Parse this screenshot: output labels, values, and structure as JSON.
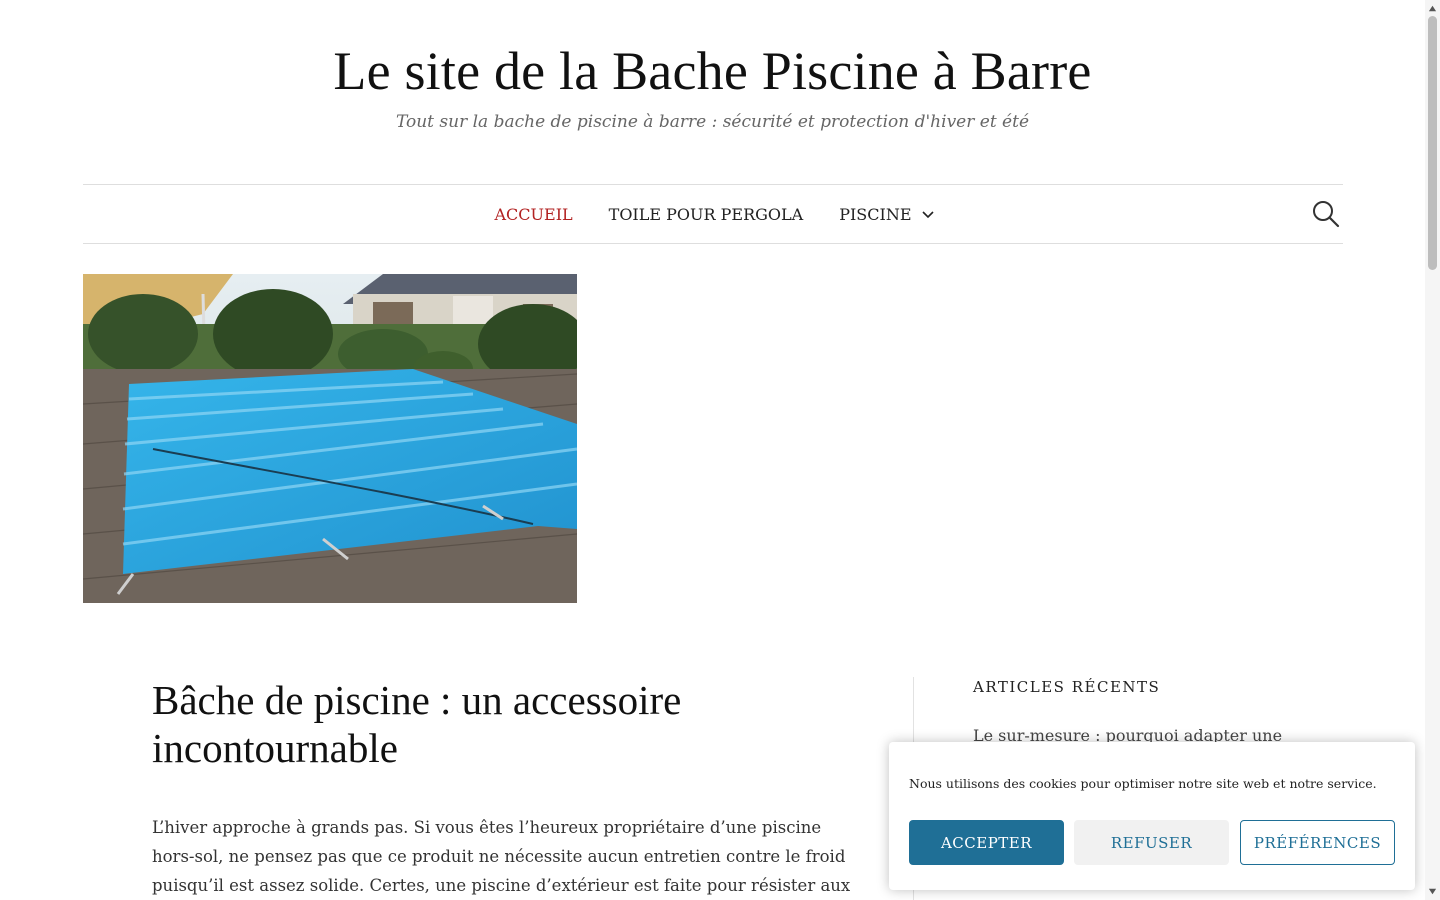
{
  "site": {
    "title": "Le site de la Bache Piscine à Barre",
    "tagline": "Tout sur la bache de piscine à barre : sécurité et protection d'hiver et été"
  },
  "nav": {
    "items": [
      {
        "label": "ACCUEIL",
        "active": true
      },
      {
        "label": "TOILE POUR PERGOLA",
        "active": false
      },
      {
        "label": "PISCINE",
        "active": false,
        "has_dropdown": true
      }
    ],
    "search_icon": "search-icon"
  },
  "post": {
    "title": "Bâche de piscine : un accessoire incontournable",
    "excerpt": "L’hiver approche à grands pas. Si vous êtes l’heureux propriétaire d’une piscine hors-sol, ne pensez pas que ce produit ne nécessite aucun entretien contre le froid puisqu’il est assez solide. Certes, une piscine d’extérieur est faite pour résister aux"
  },
  "sidebar": {
    "heading": "ARTICLES RÉCENTS",
    "recent_link": "Le sur-mesure : pourquoi adapter une"
  },
  "cookie": {
    "text": "Nous utilisons des cookies pour optimiser notre site web et notre service.",
    "accept": "ACCEPTER",
    "refuse": "REFUSER",
    "preferences": "PRÉFÉRENCES"
  },
  "colors": {
    "accent": "#1f6f96",
    "active_nav": "#b22222",
    "pool_cover": "#2fa8e0"
  }
}
